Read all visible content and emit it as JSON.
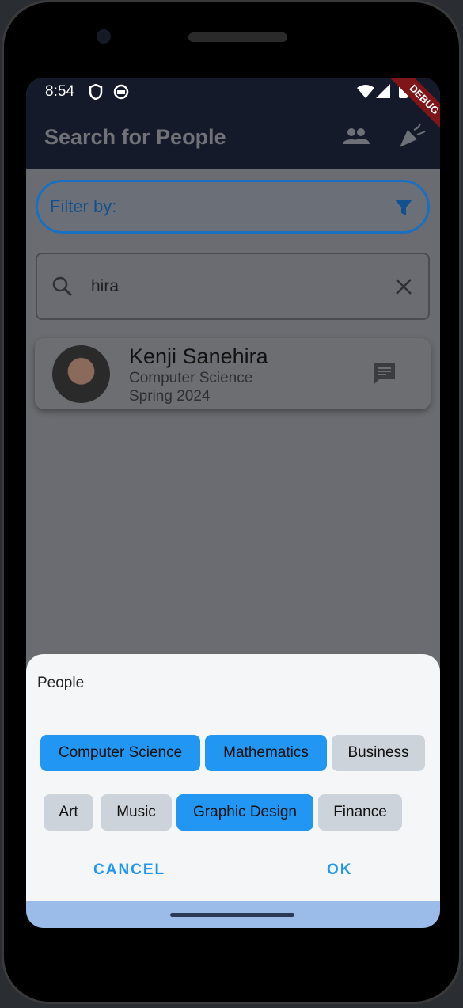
{
  "status": {
    "time": "8:54",
    "icons": [
      "shield-icon",
      "cat-icon",
      "wifi-icon",
      "signal-icon",
      "battery-icon"
    ],
    "debug": "DEBUG"
  },
  "appbar": {
    "title": "Search for People",
    "icons": [
      "people-icon",
      "celebration-icon"
    ]
  },
  "filter": {
    "label": "Filter by:"
  },
  "search": {
    "value": "hira"
  },
  "results": [
    {
      "name": "Kenji Sanehira",
      "major": "Computer Science",
      "term": "Spring 2024"
    }
  ],
  "sheet": {
    "title": "People",
    "chips": [
      {
        "label": "Computer Science",
        "selected": true
      },
      {
        "label": "Mathematics",
        "selected": true
      },
      {
        "label": "Business",
        "selected": false
      },
      {
        "label": "Art",
        "selected": false
      },
      {
        "label": "Music",
        "selected": false
      },
      {
        "label": "Graphic Design",
        "selected": true
      },
      {
        "label": "Finance",
        "selected": false
      }
    ],
    "cancel": "CANCEL",
    "ok": "OK"
  },
  "colors": {
    "accent": "#2196f3",
    "appbar": "#141a29"
  }
}
